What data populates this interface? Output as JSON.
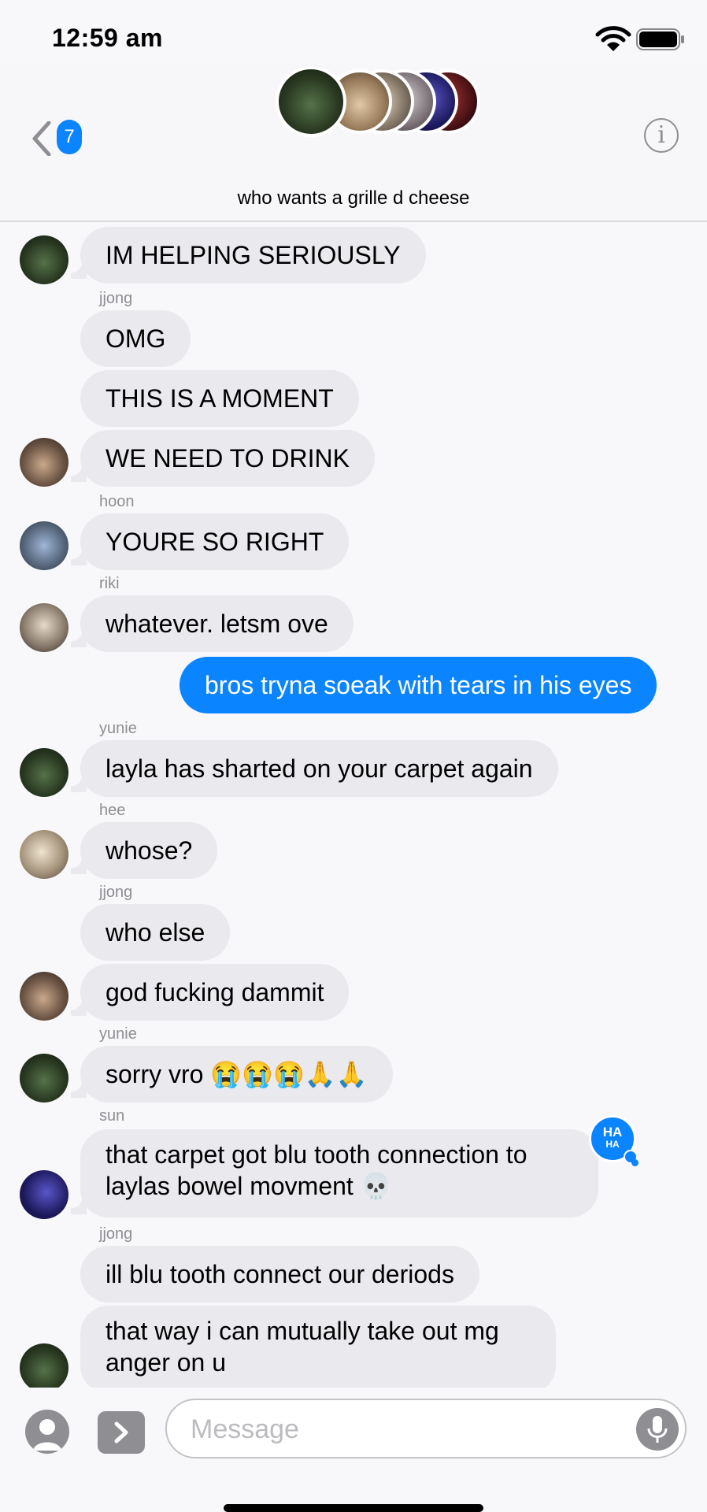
{
  "status_bar": {
    "time": "12:59 am"
  },
  "header": {
    "back_badge": "7",
    "title": "who wants a grille d cheese",
    "info_glyph": "i"
  },
  "messages": [
    {
      "text": "IM HELPING SERIOUSLY"
    },
    {
      "sender": "jjong",
      "text": "OMG"
    },
    {
      "text": "THIS IS A MOMENT"
    },
    {
      "text": "WE NEED TO DRINK"
    },
    {
      "sender": "hoon",
      "text": "YOURE SO RIGHT"
    },
    {
      "sender": "riki",
      "text": "whatever. letsm ove"
    },
    {
      "text": "bros tryna soeak with tears in his eyes",
      "outgoing": true
    },
    {
      "sender": "yunie",
      "text": "layla has sharted on your carpet again"
    },
    {
      "sender": "hee",
      "text": "whose?"
    },
    {
      "sender": "jjong",
      "text": "who else"
    },
    {
      "text": "god fucking dammit"
    },
    {
      "sender": "yunie",
      "text": "sorry vro 😭😭😭🙏🙏"
    },
    {
      "sender": "sun",
      "text": "that carpet got blu tooth connection to\nlaylas bowel movment 💀",
      "reaction": "HA HA"
    },
    {
      "sender": "jjong",
      "text": "ill blu tooth connect our deriods"
    },
    {
      "text": "that way i can mutually take out mg\nanger on u"
    }
  ],
  "reaction": {
    "line1": "HA",
    "line2": "HA"
  },
  "compose": {
    "placeholder": "Message"
  },
  "icons": [
    "back-chevron-icon",
    "info-icon",
    "wifi-icon",
    "battery-icon",
    "camera-icon",
    "apps-chevron-icon",
    "microphone-icon",
    "haha-reaction-icon"
  ],
  "colors": {
    "accent": "#0a84ff",
    "bubble_received": "#e9e9ee",
    "background": "#f8f8fa",
    "muted": "#8e8e93"
  }
}
